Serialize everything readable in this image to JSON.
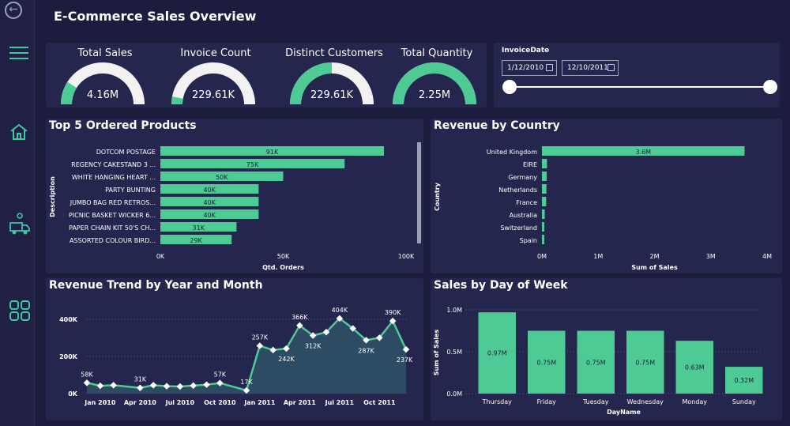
{
  "header": {
    "title": "E-Commerce Sales Overview"
  },
  "kpis": [
    {
      "label": "Total Sales",
      "value": "4.16M",
      "fraction": 0.18
    },
    {
      "label": "Invoice Count",
      "value": "229.61K",
      "fraction": 0.06
    },
    {
      "label": "Distinct Customers",
      "value": "229.61K",
      "fraction": 0.5
    },
    {
      "label": "Total Quantity",
      "value": "2.25M",
      "fraction": 1.0
    }
  ],
  "slicer": {
    "label": "InvoiceDate",
    "start": "1/12/2010",
    "end": "12/10/2011"
  },
  "top_products": {
    "title": "Top 5 Ordered Products",
    "ylabel": "Description",
    "xlabel": "Qtd. Orders",
    "ticks": [
      "0K",
      "50K",
      "100K"
    ]
  },
  "revenue_country": {
    "title": "Revenue by Country",
    "ylabel": "Country",
    "xlabel": "Sum of Sales",
    "ticks": [
      "0M",
      "1M",
      "2M",
      "3M",
      "4M"
    ]
  },
  "trend": {
    "title": "Revenue Trend by Year and Month",
    "yticks": [
      "400K",
      "200K",
      "0K"
    ],
    "xticks": [
      "Jan 2010",
      "Apr 2010",
      "Jul 2010",
      "Oct 2010",
      "Jan 2011",
      "Apr 2011",
      "Jul 2011",
      "Oct 2011"
    ]
  },
  "dow": {
    "title": "Sales by Day of Week",
    "ylabel": "Sum of Sales",
    "xlabel": "DayName",
    "yticks": [
      "1.0M",
      "0.5M",
      "0.0M"
    ]
  },
  "colors": {
    "accent": "#4ecb95",
    "panel": "#24264e",
    "bg": "#1b1c3e"
  },
  "chart_data": [
    {
      "type": "bar",
      "title": "Top 5 Ordered Products",
      "xlabel": "Qtd. Orders",
      "ylabel": "Description",
      "categories": [
        "DOTCOM POSTAGE",
        "REGENCY CAKESTAND 3 ...",
        "WHITE HANGING HEART ...",
        "PARTY BUNTING",
        "JUMBO BAG RED RETROS...",
        "PICNIC BASKET WICKER 6...",
        "PAPER CHAIN KIT 50'S CH...",
        "ASSORTED COLOUR BIRD..."
      ],
      "values": [
        91000,
        75000,
        50000,
        40000,
        40000,
        40000,
        31000,
        29000
      ],
      "labels": [
        "91K",
        "75K",
        "50K",
        "40K",
        "40K",
        "40K",
        "31K",
        "29K"
      ],
      "xlim": [
        0,
        100000
      ]
    },
    {
      "type": "bar",
      "title": "Revenue by Country",
      "xlabel": "Sum of Sales",
      "ylabel": "Country",
      "categories": [
        "United Kingdom",
        "EIRE",
        "Germany",
        "Netherlands",
        "France",
        "Australia",
        "Switzerland",
        "Spain"
      ],
      "values": [
        3600000,
        90000,
        85000,
        80000,
        75000,
        50000,
        30000,
        25000
      ],
      "labels": [
        "3.6M",
        "",
        "",
        "",
        "",
        "",
        "",
        ""
      ],
      "xlim": [
        0,
        4000000
      ]
    },
    {
      "type": "area",
      "title": "Revenue Trend by Year and Month",
      "x": [
        "Dec 2009",
        "Jan 2010",
        "Feb 2010",
        "Mar 2010",
        "Apr 2010",
        "May 2010",
        "Jun 2010",
        "Jul 2010",
        "Aug 2010",
        "Sep 2010",
        "Oct 2010",
        "Nov 2010",
        "Dec 2010",
        "Jan 2011",
        "Feb 2011",
        "Mar 2011",
        "Apr 2011",
        "May 2011",
        "Jun 2011",
        "Jul 2011",
        "Aug 2011",
        "Sep 2011",
        "Oct 2011",
        "Nov 2011",
        "Dec 2011"
      ],
      "values": [
        58000,
        42000,
        45000,
        null,
        31000,
        45000,
        40000,
        38000,
        43000,
        48000,
        57000,
        null,
        17000,
        257000,
        234000,
        242000,
        366000,
        312000,
        330000,
        404000,
        350000,
        287000,
        300000,
        390000,
        237000
      ],
      "labels": {
        "0": "58K",
        "4": "31K",
        "10": "57K",
        "12": "17K",
        "13": "257K",
        "15": "242K",
        "16": "366K",
        "17": "312K",
        "19": "404K",
        "21": "287K",
        "23": "390K",
        "24": "237K"
      },
      "ylim": [
        0,
        450000
      ]
    },
    {
      "type": "bar",
      "title": "Sales by Day of Week",
      "xlabel": "DayName",
      "ylabel": "Sum of Sales",
      "categories": [
        "Thursday",
        "Friday",
        "Tuesday",
        "Wednesday",
        "Monday",
        "Sunday"
      ],
      "values": [
        0.97,
        0.75,
        0.75,
        0.75,
        0.63,
        0.32
      ],
      "labels": [
        "0.97M",
        "0.75M",
        "0.75M",
        "0.75M",
        "0.63M",
        "0.32M"
      ],
      "ylim": [
        0,
        1.1
      ]
    }
  ]
}
